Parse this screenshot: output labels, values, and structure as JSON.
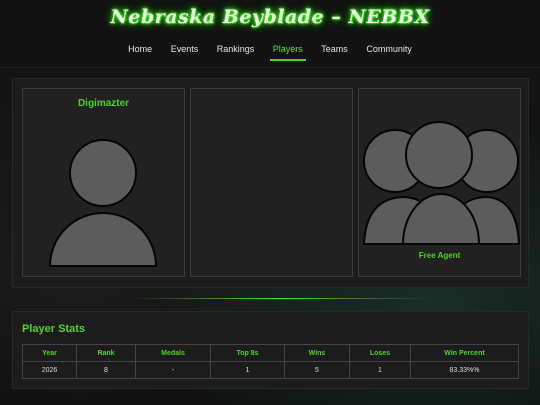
{
  "site": {
    "title": "Nebraska Beyblade – NEBBX"
  },
  "nav": [
    {
      "label": "Home",
      "active": false
    },
    {
      "label": "Events",
      "active": false
    },
    {
      "label": "Rankings",
      "active": false
    },
    {
      "label": "Players",
      "active": true
    },
    {
      "label": "Teams",
      "active": false
    },
    {
      "label": "Community",
      "active": false
    }
  ],
  "player": {
    "name": "Digimazter",
    "team_status": "Free Agent"
  },
  "stats": {
    "title": "Player Stats",
    "columns": [
      "Year",
      "Rank",
      "Medals",
      "Top 8s",
      "Wins",
      "Loses",
      "Win Percent"
    ],
    "rows": [
      [
        "2026",
        "8",
        "-",
        "1",
        "5",
        "1",
        "83.33%%"
      ]
    ]
  },
  "colors": {
    "accent": "#52d321",
    "panel": "#1b1c1b",
    "card": "#202120"
  }
}
